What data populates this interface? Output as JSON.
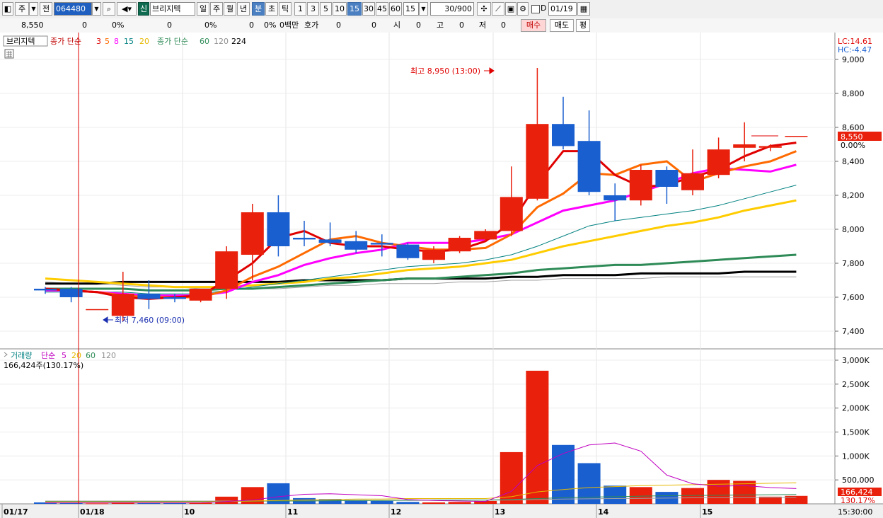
{
  "toolbar": {
    "type_label": "주",
    "prev_label": "전",
    "code": "064480",
    "shin": "신",
    "name": "브리지텍",
    "periods": [
      "일",
      "주",
      "월",
      "년",
      "분",
      "초",
      "틱"
    ],
    "minutes": [
      "1",
      "3",
      "5",
      "10",
      "15",
      "30",
      "45",
      "60"
    ],
    "interval": "15",
    "count": "30/900",
    "d_label": "D",
    "date": "01/19"
  },
  "quote": {
    "price": "8,550",
    "v1": "0",
    "p1": "0%",
    "v2": "0",
    "p2": "0%",
    "v3": "0",
    "p3": "0%",
    "unit": "0백만",
    "hoga_label": "호가",
    "h1": "0",
    "h2": "0",
    "si_label": "시",
    "si": "0",
    "go_label": "고",
    "go": "0",
    "jeo_label": "저",
    "jeo": "0",
    "buy": "매수",
    "sell": "매도",
    "avg": "평"
  },
  "price_panel": {
    "name": "브리지텍",
    "ma_label": "종가 단순",
    "ma_short": [
      "3",
      "5",
      "8",
      "15",
      "20"
    ],
    "ma_long_label": "종가 단순",
    "ma_long": [
      "60",
      "120",
      "224"
    ],
    "lc": "LC:14.61",
    "hc": "HC:-4.47",
    "current_price": "8,550",
    "current_pct": "0.00%",
    "high_annot": "최고 8,950 (13:00)",
    "low_annot": "최저 7,460 (09:00)",
    "yticks": [
      "9,000",
      "8,800",
      "8,600",
      "8,400",
      "8,200",
      "8,000",
      "7,800",
      "7,600",
      "7,400"
    ]
  },
  "volume_panel": {
    "label": "거래량",
    "ma_label": "단순",
    "ma": [
      "5",
      "20",
      "60",
      "120"
    ],
    "info": "166,424주(130.17%)",
    "yticks": [
      "3,000K",
      "2,500K",
      "2,000K",
      "1,500K",
      "1,000K",
      "500,000"
    ],
    "current": "166,424",
    "current_pct": "130.17%"
  },
  "xaxis": {
    "labels": [
      {
        "t": "01/17",
        "x": 5
      },
      {
        "t": "01/18",
        "x": 113
      },
      {
        "t": "10",
        "x": 260
      },
      {
        "t": "11",
        "x": 406
      },
      {
        "t": "12",
        "x": 552
      },
      {
        "t": "13",
        "x": 699
      },
      {
        "t": "14",
        "x": 845
      },
      {
        "t": "15",
        "x": 992
      }
    ],
    "time": "15:30:00"
  },
  "colors": {
    "up": "#e8200c",
    "down": "#1a5fd0",
    "ma3": "#e00000",
    "ma5": "#ff6a00",
    "ma8": "#ff00ff",
    "ma15": "#008080",
    "ma20": "#ffcc00",
    "ma60": "#2e8b57",
    "ma120": "#a0a0a0",
    "ma224": "#000000"
  },
  "chart_data": {
    "type": "candlestick",
    "interval_min": 15,
    "candles": [
      {
        "o": 7650,
        "h": 7660,
        "l": 7620,
        "c": 7640
      },
      {
        "o": 7650,
        "h": 7660,
        "l": 7570,
        "c": 7600
      },
      {
        "o": 7530,
        "h": 7530,
        "l": 7530,
        "c": 7530
      },
      {
        "o": 7490,
        "h": 7750,
        "l": 7460,
        "c": 7620
      },
      {
        "o": 7620,
        "h": 7700,
        "l": 7530,
        "c": 7590
      },
      {
        "o": 7600,
        "h": 7620,
        "l": 7570,
        "c": 7590
      },
      {
        "o": 7580,
        "h": 7650,
        "l": 7570,
        "c": 7650
      },
      {
        "o": 7650,
        "h": 7900,
        "l": 7590,
        "c": 7870
      },
      {
        "o": 7850,
        "h": 8150,
        "l": 7700,
        "c": 8100
      },
      {
        "o": 8100,
        "h": 8200,
        "l": 7840,
        "c": 7900
      },
      {
        "o": 7950,
        "h": 8050,
        "l": 7900,
        "c": 7940
      },
      {
        "o": 7940,
        "h": 8040,
        "l": 7900,
        "c": 7920
      },
      {
        "o": 7930,
        "h": 7990,
        "l": 7860,
        "c": 7880
      },
      {
        "o": 7920,
        "h": 7970,
        "l": 7840,
        "c": 7910
      },
      {
        "o": 7910,
        "h": 7920,
        "l": 7820,
        "c": 7830
      },
      {
        "o": 7820,
        "h": 7900,
        "l": 7800,
        "c": 7880
      },
      {
        "o": 7870,
        "h": 7960,
        "l": 7860,
        "c": 7950
      },
      {
        "o": 7940,
        "h": 8000,
        "l": 7930,
        "c": 7990
      },
      {
        "o": 7990,
        "h": 8370,
        "l": 7960,
        "c": 8190
      },
      {
        "o": 8180,
        "h": 8950,
        "l": 8170,
        "c": 8620
      },
      {
        "o": 8620,
        "h": 8780,
        "l": 8470,
        "c": 8490
      },
      {
        "o": 8520,
        "h": 8700,
        "l": 8200,
        "c": 8220
      },
      {
        "o": 8200,
        "h": 8270,
        "l": 8050,
        "c": 8170
      },
      {
        "o": 8170,
        "h": 8380,
        "l": 8140,
        "c": 8350
      },
      {
        "o": 8350,
        "h": 8370,
        "l": 8150,
        "c": 8250
      },
      {
        "o": 8230,
        "h": 8470,
        "l": 8200,
        "c": 8330
      },
      {
        "o": 8320,
        "h": 8540,
        "l": 8300,
        "c": 8470
      },
      {
        "o": 8480,
        "h": 8630,
        "l": 8400,
        "c": 8500
      },
      {
        "o": 8480,
        "h": 8500,
        "l": 8460,
        "c": 8490
      },
      {
        "o": 8550,
        "h": 8550,
        "l": 8550,
        "c": 8550
      }
    ],
    "ma3": [
      7650,
      7640,
      7630,
      7600,
      7590,
      7600,
      7610,
      7700,
      7800,
      7950,
      7990,
      7920,
      7900,
      7900,
      7880,
      7870,
      7880,
      7930,
      8040,
      8270,
      8460,
      8460,
      8320,
      8250,
      8260,
      8310,
      8350,
      8430,
      8490,
      8510
    ],
    "ma5": [
      7650,
      7640,
      7630,
      7610,
      7600,
      7600,
      7600,
      7640,
      7720,
      7780,
      7860,
      7940,
      7960,
      7920,
      7900,
      7880,
      7880,
      7890,
      7970,
      8130,
      8210,
      8330,
      8320,
      8380,
      8400,
      8280,
      8330,
      8370,
      8400,
      8460
    ],
    "ma8": [
      7640,
      7640,
      7630,
      7620,
      7610,
      7610,
      7610,
      7630,
      7690,
      7730,
      7790,
      7830,
      7860,
      7880,
      7920,
      7920,
      7920,
      7940,
      7970,
      8040,
      8110,
      8140,
      8170,
      8220,
      8270,
      8330,
      8360,
      8350,
      8340,
      8380
    ],
    "ma15": [
      7630,
      7630,
      7630,
      7630,
      7620,
      7620,
      7620,
      7640,
      7660,
      7680,
      7700,
      7720,
      7740,
      7760,
      7780,
      7790,
      7800,
      7820,
      7850,
      7900,
      7960,
      8020,
      8050,
      8070,
      8090,
      8110,
      8140,
      8180,
      8220,
      8260
    ],
    "ma20": [
      7710,
      7700,
      7690,
      7680,
      7670,
      7660,
      7660,
      7660,
      7670,
      7680,
      7690,
      7710,
      7720,
      7740,
      7760,
      7770,
      7780,
      7800,
      7820,
      7860,
      7900,
      7930,
      7960,
      7990,
      8020,
      8040,
      8070,
      8110,
      8140,
      8170
    ],
    "ma60": [
      7650,
      7650,
      7650,
      7650,
      7640,
      7640,
      7640,
      7650,
      7650,
      7660,
      7670,
      7680,
      7690,
      7700,
      7710,
      7710,
      7720,
      7730,
      7740,
      7760,
      7770,
      7780,
      7790,
      7790,
      7800,
      7810,
      7820,
      7830,
      7840,
      7850
    ],
    "ma120": [
      7690,
      7680,
      7680,
      7670,
      7660,
      7660,
      7650,
      7650,
      7650,
      7650,
      7660,
      7670,
      7670,
      7680,
      7680,
      7680,
      7690,
      7690,
      7700,
      7700,
      7710,
      7710,
      7710,
      7710,
      7720,
      7720,
      7720,
      7720,
      7720,
      7720
    ],
    "ma224": [
      7680,
      7680,
      7680,
      7690,
      7690,
      7690,
      7690,
      7690,
      7690,
      7690,
      7700,
      7700,
      7700,
      7700,
      7710,
      7710,
      7710,
      7710,
      7720,
      7720,
      7730,
      7730,
      7730,
      7740,
      7740,
      7740,
      7740,
      7750,
      7750,
      7750
    ],
    "volume": [
      30,
      20,
      10,
      30,
      20,
      15,
      20,
      150,
      350,
      430,
      120,
      100,
      80,
      60,
      40,
      30,
      40,
      60,
      1080,
      2780,
      1230,
      850,
      380,
      350,
      250,
      330,
      500,
      480,
      150,
      166
    ],
    "vol_ma5": [
      20,
      20,
      20,
      20,
      20,
      20,
      20,
      50,
      80,
      150,
      200,
      210,
      190,
      170,
      90,
      70,
      60,
      50,
      260,
      800,
      1050,
      1230,
      1270,
      1100,
      600,
      420,
      370,
      380,
      340,
      320
    ],
    "vol_ma20": [
      40,
      40,
      40,
      40,
      40,
      40,
      40,
      50,
      60,
      70,
      80,
      90,
      100,
      100,
      110,
      110,
      110,
      110,
      150,
      250,
      300,
      340,
      360,
      380,
      390,
      400,
      410,
      420,
      430,
      440
    ],
    "vol_ma60": [
      50,
      50,
      50,
      50,
      50,
      50,
      50,
      50,
      55,
      60,
      60,
      65,
      70,
      70,
      75,
      80,
      80,
      80,
      90,
      110,
      130,
      140,
      150,
      160,
      170,
      175,
      180,
      185,
      190,
      195
    ],
    "vol_ma120": [
      60,
      60,
      60,
      60,
      60,
      60,
      60,
      60,
      60,
      62,
      64,
      66,
      68,
      70,
      72,
      74,
      76,
      78,
      80,
      90,
      100,
      105,
      110,
      115,
      120,
      125,
      128,
      130,
      132,
      134
    ]
  }
}
